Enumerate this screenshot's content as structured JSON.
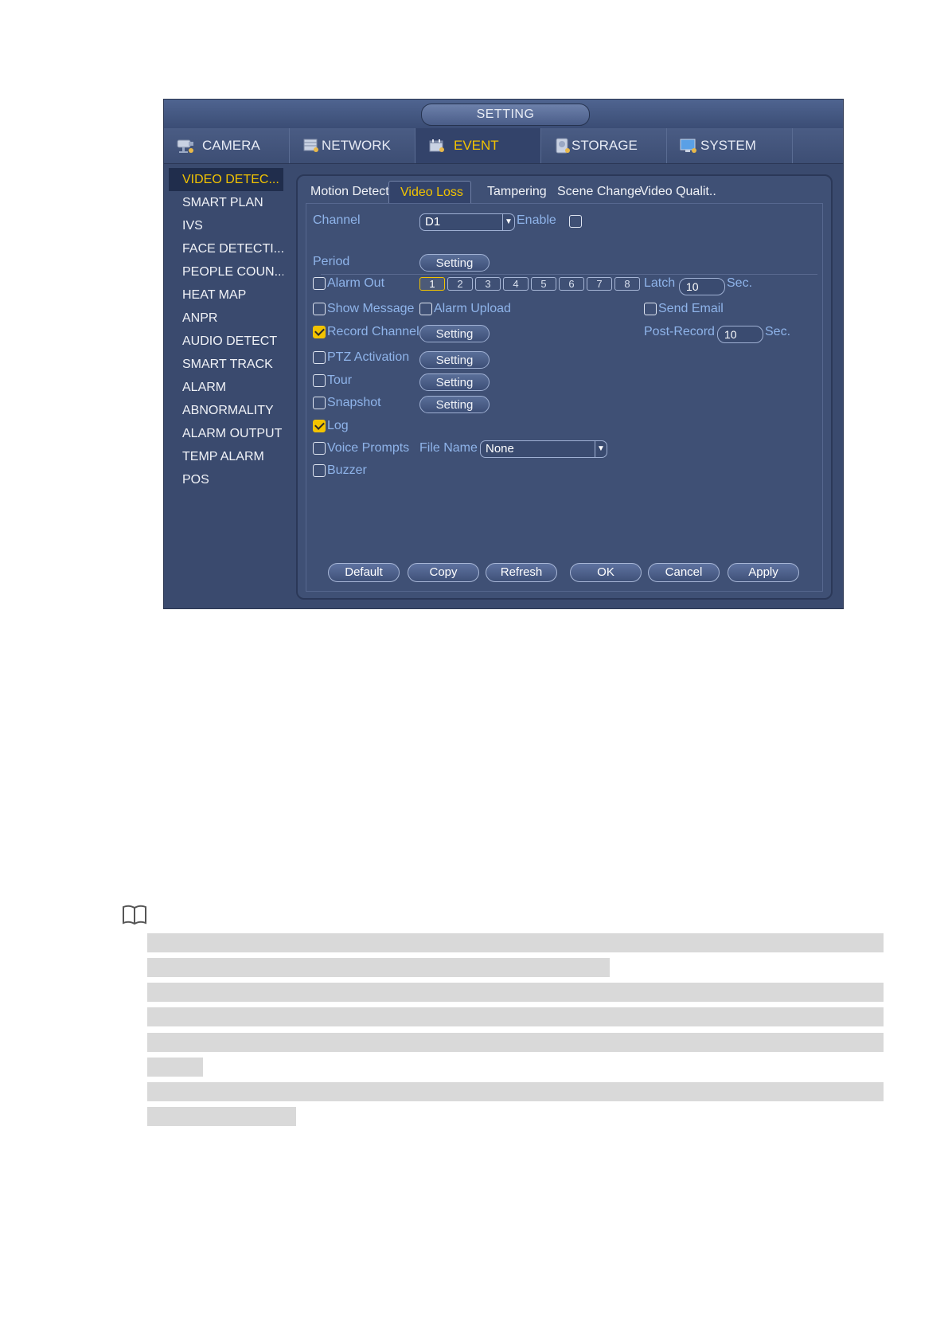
{
  "window": {
    "title": "SETTING"
  },
  "main_tabs": [
    {
      "label": "CAMERA",
      "icon": "camera-icon",
      "active": false
    },
    {
      "label": "NETWORK",
      "icon": "network-icon",
      "active": false
    },
    {
      "label": "EVENT",
      "icon": "event-icon",
      "active": true
    },
    {
      "label": "STORAGE",
      "icon": "storage-icon",
      "active": false
    },
    {
      "label": "SYSTEM",
      "icon": "system-icon",
      "active": false
    }
  ],
  "sidebar": {
    "items": [
      {
        "label": "VIDEO DETEC...",
        "active": true
      },
      {
        "label": "SMART PLAN"
      },
      {
        "label": "IVS"
      },
      {
        "label": "FACE DETECTI..."
      },
      {
        "label": "PEOPLE COUN..."
      },
      {
        "label": "HEAT MAP"
      },
      {
        "label": "ANPR"
      },
      {
        "label": "AUDIO DETECT"
      },
      {
        "label": "SMART TRACK"
      },
      {
        "label": "ALARM"
      },
      {
        "label": "ABNORMALITY"
      },
      {
        "label": "ALARM OUTPUT"
      },
      {
        "label": "TEMP ALARM"
      },
      {
        "label": "POS"
      }
    ]
  },
  "sub_tabs": [
    {
      "label": "Motion Detect"
    },
    {
      "label": "Video Loss",
      "active": true
    },
    {
      "label": "Tampering"
    },
    {
      "label": "Scene Change"
    },
    {
      "label": "Video Qualit.."
    }
  ],
  "form": {
    "channel_label": "Channel",
    "channel_value": "D1",
    "enable_label": "Enable",
    "enable_checked": false,
    "period_label": "Period",
    "setting_label": "Setting",
    "alarm_out_label": "Alarm Out",
    "alarm_out_checked": false,
    "alarm_out_channels": [
      "1",
      "2",
      "3",
      "4",
      "5",
      "6",
      "7",
      "8"
    ],
    "alarm_out_selected": "1",
    "latch_label": "Latch",
    "latch_value": "10",
    "sec_label": "Sec.",
    "show_message_label": "Show Message",
    "alarm_upload_label": "Alarm Upload",
    "send_email_label": "Send Email",
    "record_channel_label": "Record Channel",
    "record_channel_checked": true,
    "post_record_label": "Post-Record",
    "post_record_value": "10",
    "ptz_activation_label": "PTZ Activation",
    "tour_label": "Tour",
    "snapshot_label": "Snapshot",
    "log_label": "Log",
    "log_checked": true,
    "voice_prompts_label": "Voice Prompts",
    "file_name_label": "File Name",
    "file_name_value": "None",
    "buzzer_label": "Buzzer"
  },
  "bottom_buttons": [
    "Default",
    "Copy",
    "Refresh",
    "OK",
    "Cancel",
    "Apply"
  ],
  "colors": {
    "accent": "#f2c300",
    "window_bg": "#3a4a6e",
    "label_blue": "#8fb4ea"
  },
  "note": {
    "icon": "book-icon"
  }
}
